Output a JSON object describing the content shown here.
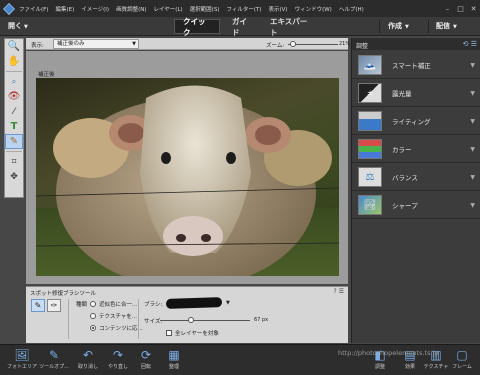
{
  "menubar": {
    "items": [
      "ファイル(F)",
      "編集(E)",
      "イメージ(I)",
      "画質調整(N)",
      "レイヤー(L)",
      "選択範囲(S)",
      "フィルター(T)",
      "表示(V)",
      "ウィンドウ(W)",
      "ヘルプ(H)"
    ],
    "minimize": "–",
    "maximize": "□",
    "close": "✕"
  },
  "modebar": {
    "open": "開く",
    "tabs": [
      "クイック",
      "ガイド",
      "エキスパート"
    ],
    "active_tab": "クイック",
    "create": "作成",
    "share": "配信"
  },
  "viewbar": {
    "view_label": "表示:",
    "view_value": "補正後のみ",
    "zoom_label": "ズーム:",
    "zoom_value": "21%"
  },
  "canvas": {
    "label": "補正後"
  },
  "panel": {
    "title": "調整",
    "items": [
      {
        "label": "スマート補正",
        "icon": "smart-fix-icon"
      },
      {
        "label": "露光量",
        "icon": "exposure-icon"
      },
      {
        "label": "ライティング",
        "icon": "lighting-icon"
      },
      {
        "label": "カラー",
        "icon": "color-icon"
      },
      {
        "label": "バランス",
        "icon": "balance-icon"
      },
      {
        "label": "シャープ",
        "icon": "sharpen-icon"
      }
    ]
  },
  "tool_options": {
    "title": "スポット修復ブラシツール",
    "type_label": "種類",
    "radios": [
      "近似色に合一...",
      "テクスチャを...",
      "コンテンツに応..."
    ],
    "selected_radio": 2,
    "brush_label": "ブラシ:",
    "size_label": "サイズ:",
    "size_value": "67 px",
    "sample_all_layers": "全レイヤーを対象"
  },
  "taskbar": {
    "items": [
      "フォトエリア",
      "ツールオプ...",
      "取り消し",
      "やり直し",
      "回転",
      "整理"
    ],
    "right_items": [
      "調整",
      "効果",
      "テクスチャ",
      "フレーム"
    ]
  },
  "watermark": "http://photoshopelements.ts.jp"
}
